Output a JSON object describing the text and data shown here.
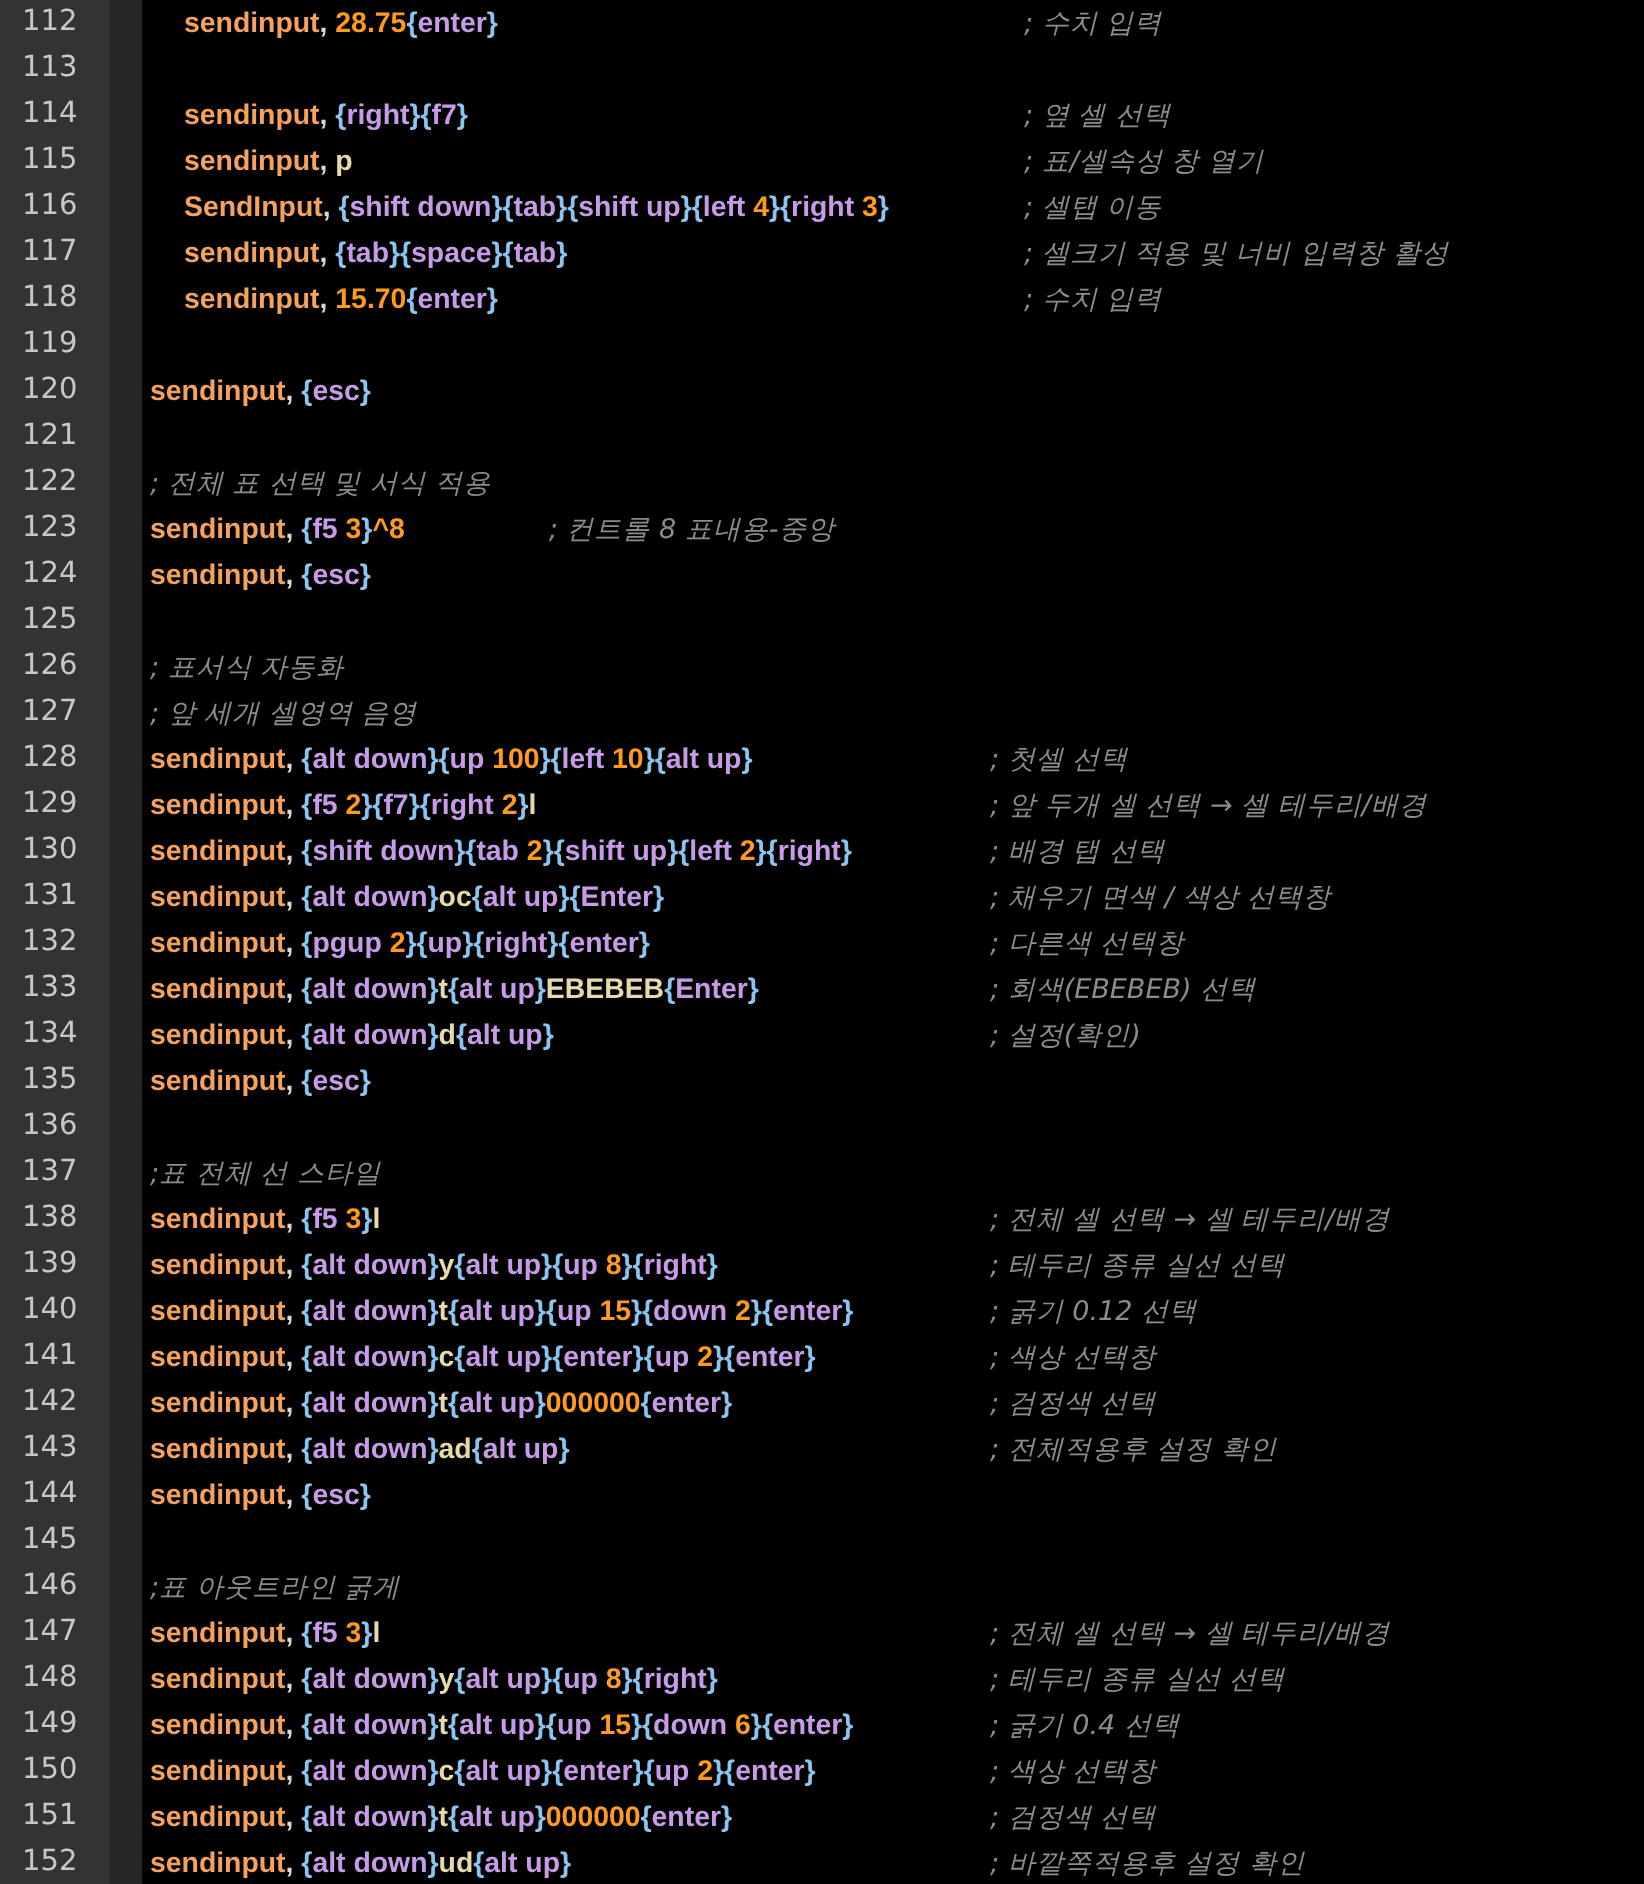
{
  "lines": [
    {
      "number": "112",
      "kind": "nested",
      "code": "sendinput, 28.75{enter}",
      "comment": "; 수치 입력"
    },
    {
      "number": "113",
      "kind": "blank"
    },
    {
      "number": "114",
      "kind": "nested",
      "code": "sendinput, {right}{f7}",
      "comment": "; 옆 셀 선택"
    },
    {
      "number": "115",
      "kind": "nested",
      "code": "sendinput, p",
      "comment": "; 표/셀속성 창 열기"
    },
    {
      "number": "116",
      "kind": "nested",
      "code": "SendInput, {shift down}{tab}{shift up}{left 4}{right 3}",
      "comment": "; 셀탭 이동"
    },
    {
      "number": "117",
      "kind": "nested",
      "code": "sendinput, {tab}{space}{tab}",
      "comment": "; 셀크기 적용 및 너비 입력창 활성"
    },
    {
      "number": "118",
      "kind": "nested",
      "code": "sendinput, 15.70{enter}",
      "comment": "; 수치 입력"
    },
    {
      "number": "119",
      "kind": "blank"
    },
    {
      "number": "120",
      "kind": "code",
      "code": "sendinput, {esc}"
    },
    {
      "number": "121",
      "kind": "blank"
    },
    {
      "number": "122",
      "kind": "note",
      "comment": "; 전체 표 선택 및 서식 적용"
    },
    {
      "number": "123",
      "kind": "inline",
      "code": "sendinput, {f5 3}^8",
      "comment": "; 컨트롤 8 표내용-중앙"
    },
    {
      "number": "124",
      "kind": "code",
      "code": "sendinput, {esc}"
    },
    {
      "number": "125",
      "kind": "blank"
    },
    {
      "number": "126",
      "kind": "note",
      "comment": "; 표서식 자동화"
    },
    {
      "number": "127",
      "kind": "note",
      "comment": "; 앞 세개 셀영역 음영"
    },
    {
      "number": "128",
      "kind": "code",
      "code": "sendinput, {alt down}{up 100}{left 10}{alt up}",
      "comment": "; 첫셀 선택"
    },
    {
      "number": "129",
      "kind": "code",
      "code": "sendinput, {f5 2}{f7}{right 2}l",
      "comment": "; 앞 두개 셀 선택 → 셀 테두리/배경"
    },
    {
      "number": "130",
      "kind": "code",
      "code": "sendinput, {shift down}{tab 2}{shift up}{left 2}{right}",
      "comment": "; 배경 탭 선택"
    },
    {
      "number": "131",
      "kind": "code",
      "code": "sendinput, {alt down}oc{alt up}{Enter}",
      "comment": "; 채우기 면색 / 색상 선택창"
    },
    {
      "number": "132",
      "kind": "code",
      "code": "sendinput, {pgup 2}{up}{right}{enter}",
      "comment": "; 다른색 선택창"
    },
    {
      "number": "133",
      "kind": "code",
      "code": "sendinput, {alt down}t{alt up}EBEBEB{Enter}",
      "comment": "; 회색(EBEBEB) 선택"
    },
    {
      "number": "134",
      "kind": "code",
      "code": "sendinput, {alt down}d{alt up}",
      "comment": "; 설정(확인)"
    },
    {
      "number": "135",
      "kind": "code",
      "code": "sendinput, {esc}"
    },
    {
      "number": "136",
      "kind": "blank"
    },
    {
      "number": "137",
      "kind": "note",
      "comment": ";표 전체 선 스타일"
    },
    {
      "number": "138",
      "kind": "code",
      "code": "sendinput, {f5 3}l",
      "comment": "; 전체 셀 선택 → 셀 테두리/배경"
    },
    {
      "number": "139",
      "kind": "code",
      "code": "sendinput, {alt down}y{alt up}{up 8}{right}",
      "comment": "; 테두리 종류 실선 선택"
    },
    {
      "number": "140",
      "kind": "code",
      "code": "sendinput, {alt down}t{alt up}{up 15}{down 2}{enter}",
      "comment": "; 굵기 0.12 선택"
    },
    {
      "number": "141",
      "kind": "code",
      "code": "sendinput, {alt down}c{alt up}{enter}{up 2}{enter}",
      "comment": "; 색상 선택창"
    },
    {
      "number": "142",
      "kind": "code",
      "code": "sendinput, {alt down}t{alt up}000000{enter}",
      "comment": "; 검정색 선택"
    },
    {
      "number": "143",
      "kind": "code",
      "code": "sendinput, {alt down}ad{alt up}",
      "comment": "; 전체적용후 설정 확인"
    },
    {
      "number": "144",
      "kind": "code",
      "code": "sendinput, {esc}"
    },
    {
      "number": "145",
      "kind": "blank"
    },
    {
      "number": "146",
      "kind": "note",
      "comment": ";표 아웃트라인 굵게"
    },
    {
      "number": "147",
      "kind": "code",
      "code": "sendinput, {f5 3}l",
      "comment": "; 전체 셀 선택 → 셀 테두리/배경"
    },
    {
      "number": "148",
      "kind": "code",
      "code": "sendinput, {alt down}y{alt up}{up 8}{right}",
      "comment": "; 테두리 종류 실선 선택"
    },
    {
      "number": "149",
      "kind": "code",
      "code": "sendinput, {alt down}t{alt up}{up 15}{down 6}{enter}",
      "comment": "; 굵기 0.4 선택"
    },
    {
      "number": "150",
      "kind": "code",
      "code": "sendinput, {alt down}c{alt up}{enter}{up 2}{enter}",
      "comment": "; 색상 선택창"
    },
    {
      "number": "151",
      "kind": "code",
      "code": "sendinput, {alt down}t{alt up}000000{enter}",
      "comment": "; 검정색 선택"
    },
    {
      "number": "152",
      "kind": "code",
      "code": "sendinput, {alt down}ud{alt up}",
      "comment": "; 바깥쪽적용후 설정 확인"
    }
  ]
}
